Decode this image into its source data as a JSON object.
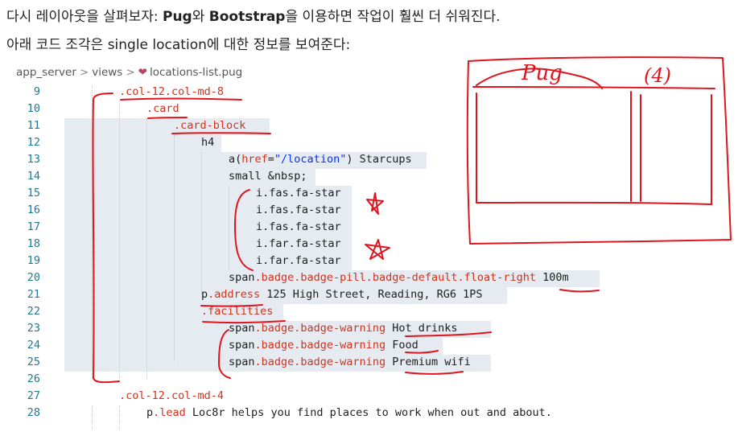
{
  "intro": {
    "line1_a": "다시 레이아웃을 살펴보자: ",
    "line1_pug": "Pug",
    "line1_b": "와 ",
    "line1_bootstrap": "Bootstrap",
    "line1_c": "을 이용하면 작업이 훨씬 더 쉬워진다.",
    "line2": "아래 코드 조각은 single location에 대한 정보를 보여준다:"
  },
  "breadcrumb": {
    "part1": "app_server",
    "part2": "views",
    "file": "locations-list.pug",
    "separator": ">"
  },
  "code_lines": [
    {
      "n": "9",
      "text": ".col-12.col-md-8"
    },
    {
      "n": "10",
      "text": ".card"
    },
    {
      "n": "11",
      "text": ".card-block"
    },
    {
      "n": "12",
      "text": "h4"
    },
    {
      "n": "13",
      "a": "a(",
      "b": "href",
      "c": "=",
      "d": "\"/location\"",
      "e": ") Starcups"
    },
    {
      "n": "14",
      "text": "small &nbsp;"
    },
    {
      "n": "15",
      "text": "i.fas.fa-star"
    },
    {
      "n": "16",
      "text": "i.fas.fa-star"
    },
    {
      "n": "17",
      "text": "i.fas.fa-star"
    },
    {
      "n": "18",
      "text": "i.far.fa-star"
    },
    {
      "n": "19",
      "text": "i.far.fa-star"
    },
    {
      "n": "20",
      "a": "span",
      "b": ".badge.badge-pill.badge-default.float-right",
      "c": " 100m"
    },
    {
      "n": "21",
      "a": "p",
      "b": ".address",
      "c": " 125 High Street, Reading, RG6 1PS"
    },
    {
      "n": "22",
      "text": ".facilities"
    },
    {
      "n": "23",
      "a": "span",
      "b": ".badge.badge-warning",
      "c": " Hot drinks"
    },
    {
      "n": "24",
      "a": "span",
      "b": ".badge.badge-warning",
      "c": " Food"
    },
    {
      "n": "25",
      "a": "span",
      "b": ".badge.badge-warning",
      "c": " Premium wifi"
    },
    {
      "n": "26",
      "text": ""
    },
    {
      "n": "27",
      "text": ".col-12.col-md-4"
    },
    {
      "n": "28",
      "a": "p",
      "b": ".lead",
      "c": " Loc8r helps you find places to work when out and about."
    }
  ],
  "sketch": {
    "left_label": "Pug",
    "right_label": "(4)"
  },
  "colors": {
    "line_number": "#237893",
    "class_token": "#d0331e",
    "string_token": "#0431fa",
    "selection": "#e5ebf1",
    "ink": "#e0141e"
  }
}
